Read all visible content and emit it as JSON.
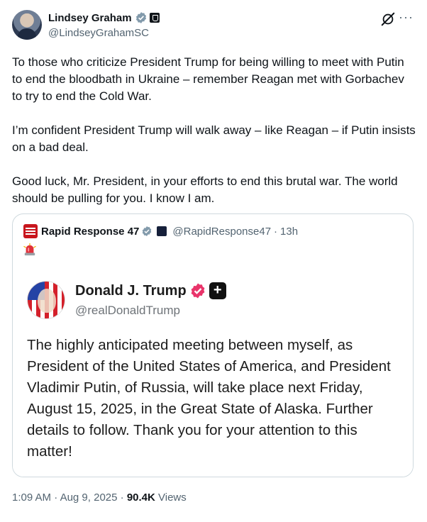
{
  "author": {
    "display_name": "Lindsey Graham",
    "handle": "@LindseyGrahamSC"
  },
  "icons": {
    "verified": "verified-badge-icon",
    "affiliation": "government-affiliation-icon",
    "grok": "grok-icon",
    "more": "more-icon",
    "siren": "siren-emoji-icon"
  },
  "colors": {
    "verified_gray": "#829aab",
    "quote_border": "#cfd9de",
    "trump_badge": "#e9346a"
  },
  "more_label": "···",
  "body": {
    "paragraphs": [
      "To those who criticize President Trump for being willing to meet with Putin to end the bloodbath in Ukraine – remember Reagan met with Gorbachev to try to end the Cold War.",
      "I’m confident President Trump will walk away – like Reagan – if Putin insists on a bad deal.",
      "Good luck, Mr. President, in your efforts to end this brutal war. The world should be pulling for you. I know I am."
    ]
  },
  "quote": {
    "display_name": "Rapid Response 47",
    "handle": "@RapidResponse47",
    "separator": "·",
    "time": "13h",
    "card": {
      "name": "Donald J. Trump",
      "plus": "+",
      "handle": "@realDonaldTrump",
      "text": "The highly anticipated meeting between myself, as President of the United States of America, and President Vladimir Putin, of Russia, will take place next Friday, August 15, 2025, in the Great State of Alaska. Further details to follow. Thank you for your attention to this matter!"
    }
  },
  "meta": {
    "time": "1:09 AM",
    "separator": " · ",
    "date": "Aug 9, 2025",
    "views_count": "90.4K",
    "views_label": " Views"
  }
}
